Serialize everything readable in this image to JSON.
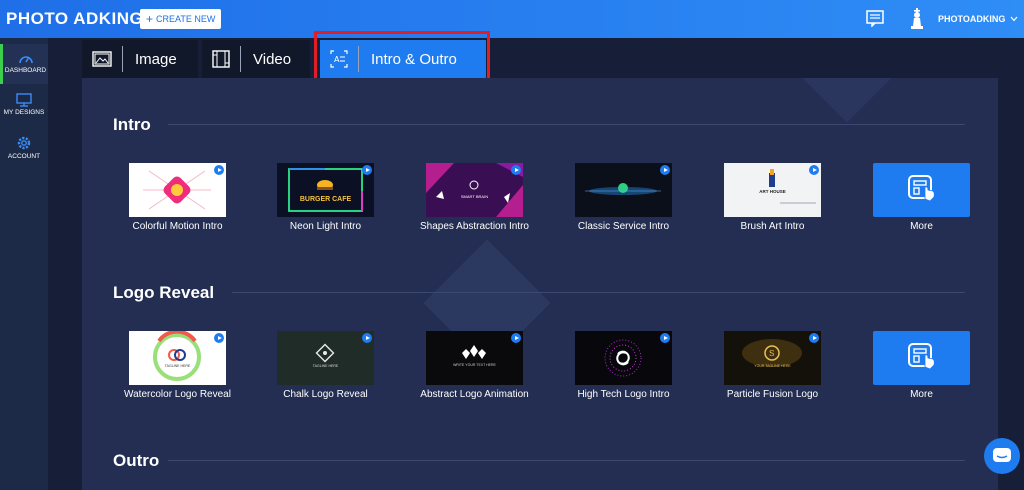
{
  "header": {
    "logo": "PHOTO ADKING",
    "create_label": "CREATE NEW",
    "username": "PHOTOADKING"
  },
  "sidebar": {
    "items": [
      {
        "label": "DASHBOARD",
        "icon": "gauge-icon",
        "active": true
      },
      {
        "label": "MY DESIGNS",
        "icon": "monitor-icon",
        "active": false
      },
      {
        "label": "ACCOUNT",
        "icon": "gear-icon",
        "active": false
      }
    ]
  },
  "tabs": [
    {
      "label": "Image",
      "icon": "image-icon",
      "active": false
    },
    {
      "label": "Video",
      "icon": "film-icon",
      "active": false
    },
    {
      "label": "Intro & Outro",
      "icon": "text-frame-icon",
      "active": true
    }
  ],
  "sections": {
    "intro": {
      "title": "Intro",
      "cards": [
        {
          "label": "Colorful Motion Intro"
        },
        {
          "label": "Neon Light Intro",
          "thumb_text": "BURGER CAFE"
        },
        {
          "label": "Shapes Abstraction Intro",
          "thumb_text": "SMART BRAIN"
        },
        {
          "label": "Classic Service Intro"
        },
        {
          "label": "Brush Art Intro",
          "thumb_text": "ART HOUSE"
        }
      ],
      "more_label": "More"
    },
    "logo_reveal": {
      "title": "Logo Reveal",
      "cards": [
        {
          "label": "Watercolor Logo Reveal",
          "thumb_text": "TAGLINE HERE"
        },
        {
          "label": "Chalk Logo Reveal",
          "thumb_text": "TAGLINE HERE"
        },
        {
          "label": "Abstract Logo Animation",
          "thumb_text": "WRITE YOUR TEXT HERE"
        },
        {
          "label": "High Tech Logo Intro"
        },
        {
          "label": "Particle Fusion Logo",
          "thumb_text": "YOUR TAGLINE HERE"
        }
      ],
      "more_label": "More"
    },
    "outro": {
      "title": "Outro"
    }
  },
  "colors": {
    "accent": "#1f7cf0",
    "highlight": "#e01e25",
    "active_indicator": "#3ccf4e",
    "background": "#232e52"
  }
}
